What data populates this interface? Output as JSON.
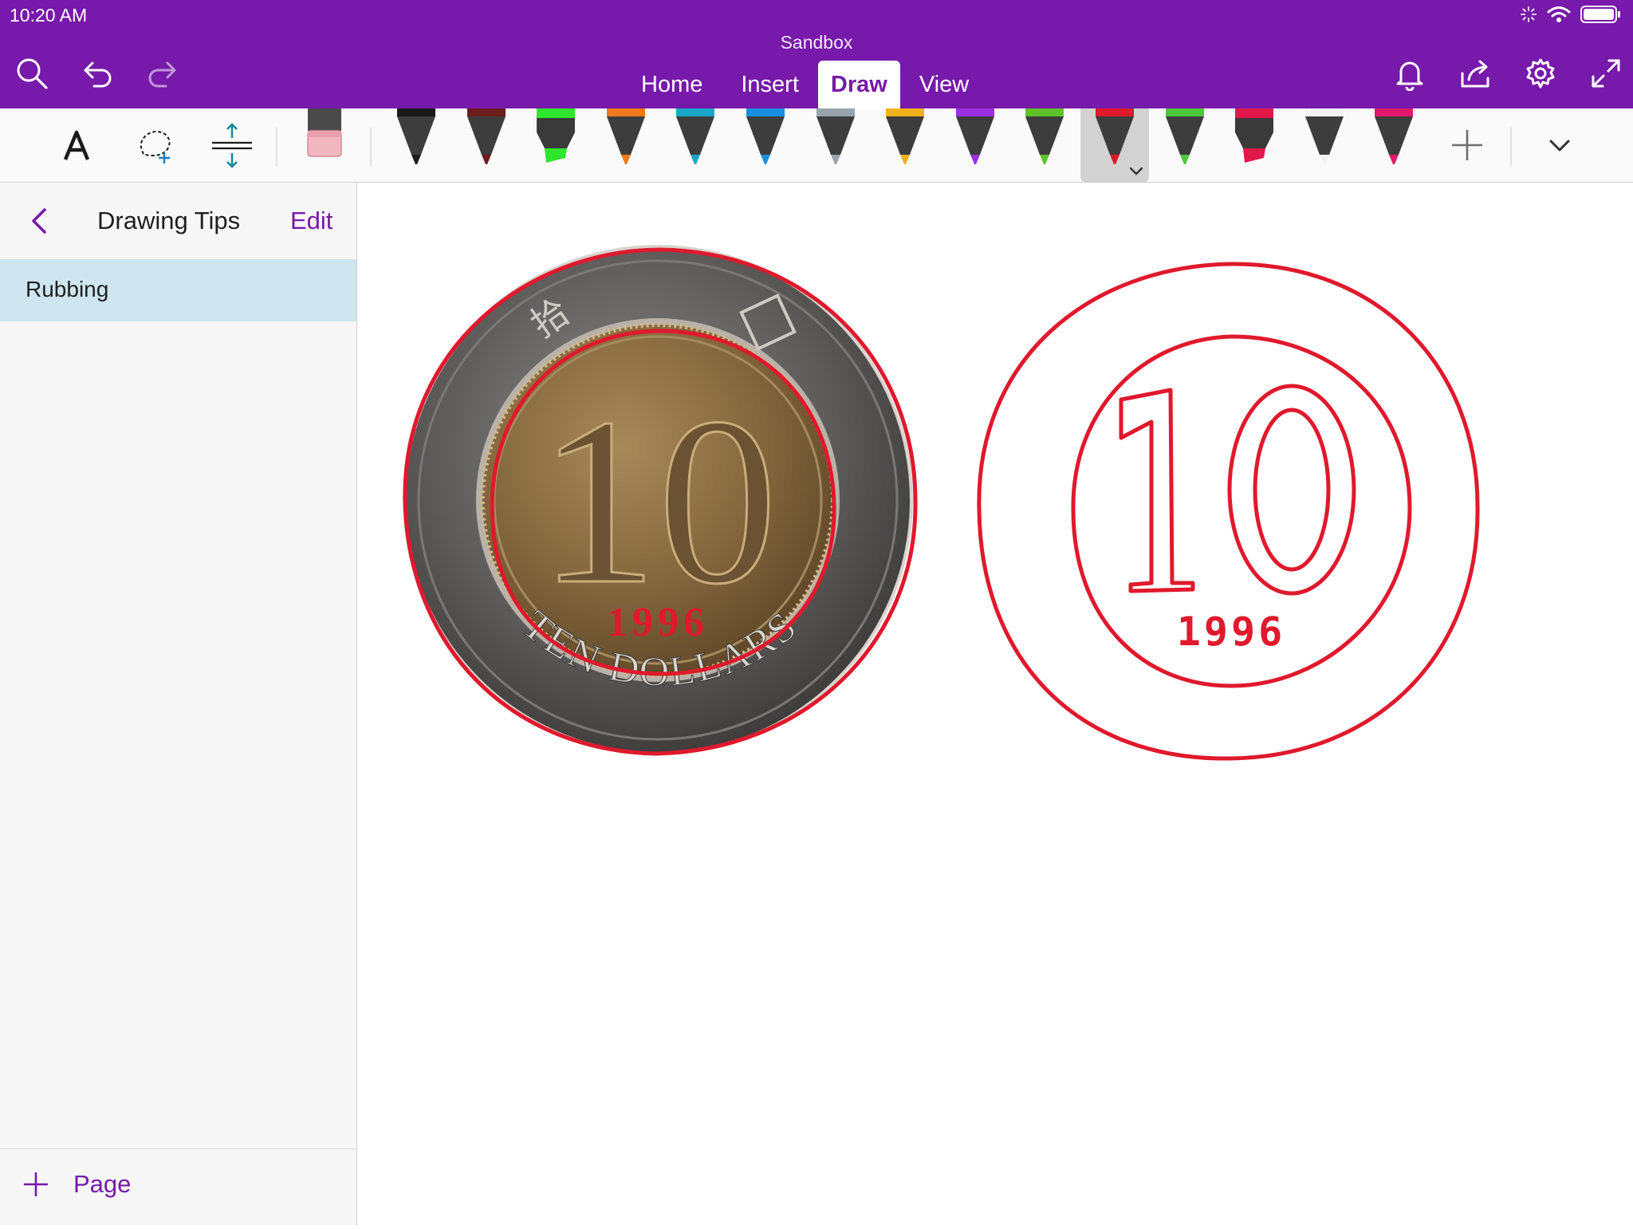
{
  "status": {
    "time": "10:20 AM"
  },
  "app": {
    "title": "Sandbox"
  },
  "tabs": [
    {
      "label": "Home",
      "active": false
    },
    {
      "label": "Insert",
      "active": false
    },
    {
      "label": "Draw",
      "active": true
    },
    {
      "label": "View",
      "active": false
    }
  ],
  "colors": {
    "accent": "#7719AA",
    "ink": "#E0192C",
    "selected_page": "#CFE6F0"
  },
  "ribbon": {
    "tools": [
      "text-mode-icon",
      "lasso-select-icon",
      "insert-space-icon",
      "eraser-icon"
    ],
    "pens": [
      {
        "kind": "pen",
        "color": "#1a1a1a"
      },
      {
        "kind": "pen",
        "color": "#6b1c1c"
      },
      {
        "kind": "highlighter",
        "color": "#2ee62e"
      },
      {
        "kind": "pen",
        "color": "#f07a1a"
      },
      {
        "kind": "pen",
        "color": "#1aa6c8"
      },
      {
        "kind": "pen",
        "color": "#1a8fe0"
      },
      {
        "kind": "pen",
        "color": "#9aa3ab"
      },
      {
        "kind": "pen",
        "color": "#f0b21a"
      },
      {
        "kind": "pen",
        "color": "#9b30e0"
      },
      {
        "kind": "pen",
        "color": "#5ec22a"
      },
      {
        "kind": "pen",
        "color": "#e0192c",
        "selected": true
      },
      {
        "kind": "pen",
        "color": "#4cc83a"
      },
      {
        "kind": "highlighter",
        "color": "#e0194a"
      },
      {
        "kind": "pen",
        "color": "#f2f2f2"
      },
      {
        "kind": "pen",
        "color": "#e01a6a"
      }
    ]
  },
  "sidebar": {
    "title": "Drawing Tips",
    "edit_label": "Edit",
    "pages": [
      {
        "title": "Rubbing",
        "selected": true
      }
    ],
    "add_page_label": "Page"
  },
  "canvas": {
    "coin_photo": {
      "denomination": "10",
      "year": "1996",
      "legend": "TEN DOLLARS"
    },
    "tracing": {
      "denomination": "10",
      "year": "1996"
    }
  }
}
